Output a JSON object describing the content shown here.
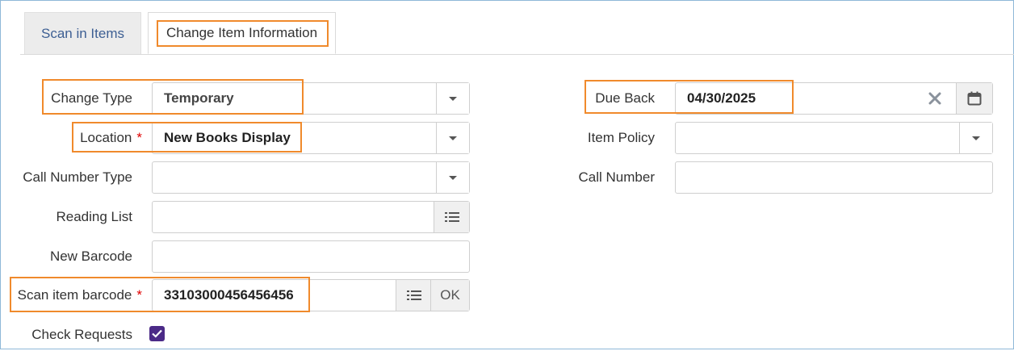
{
  "tabs": [
    {
      "label": "Scan in Items"
    },
    {
      "label": "Change Item Information"
    }
  ],
  "left_form": {
    "change_type": {
      "label": "Change Type",
      "value": "Temporary"
    },
    "location": {
      "label": "Location",
      "required_mark": "*",
      "value": "New Books Display"
    },
    "call_number_type": {
      "label": "Call Number Type",
      "value": ""
    },
    "reading_list": {
      "label": "Reading List",
      "value": ""
    },
    "new_barcode": {
      "label": "New Barcode",
      "value": ""
    },
    "scan_item_barcode": {
      "label": "Scan item barcode",
      "required_mark": "*",
      "value": "33103000456456456",
      "ok_label": "OK"
    },
    "check_requests": {
      "label": "Check Requests",
      "checked": true
    }
  },
  "right_form": {
    "due_back": {
      "label": "Due Back",
      "value": "04/30/2025"
    },
    "item_policy": {
      "label": "Item Policy",
      "value": ""
    },
    "call_number": {
      "label": "Call Number",
      "value": ""
    }
  },
  "colors": {
    "highlight": "#f08a2c",
    "checkbox": "#4b2a87",
    "tab_link": "#3d5f93",
    "required": "#e00000"
  },
  "icons": [
    "chevron-down-icon",
    "list-icon",
    "clear-x-icon",
    "calendar-icon",
    "checkmark-icon"
  ]
}
